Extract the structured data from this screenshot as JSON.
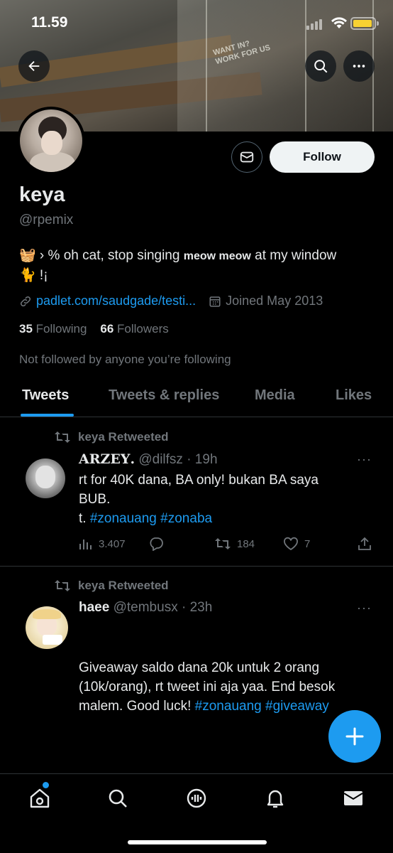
{
  "status_bar": {
    "time": "11.59"
  },
  "banner": {
    "sign_text": "WANT IN? WORK FOR US"
  },
  "profile": {
    "name": "keya",
    "handle": "@rpemix",
    "bio_prefix": "🧺 › % oh cat, stop singing ",
    "bio_bold": "meow meow",
    "bio_suffix": " at my window",
    "bio_line2": "🐈 !¡",
    "link": "padlet.com/saudgade/testi...",
    "joined": "Joined May 2013",
    "following_count": "35",
    "following_label": "Following",
    "followers_count": "66",
    "followers_label": "Followers",
    "not_followed": "Not followed by anyone you’re following",
    "follow_label": "Follow"
  },
  "tabs": [
    {
      "label": "Tweets",
      "active": true
    },
    {
      "label": "Tweets & replies"
    },
    {
      "label": "Media"
    },
    {
      "label": "Likes"
    }
  ],
  "tweets": [
    {
      "retweet_label": "keya Retweeted",
      "display_name": "𝐀𝐑𝐙𝐄𝐘.",
      "handle_time": "@dilfsz · 19h",
      "text_line1": "rt for 40K dana, BA only! bukan BA saya",
      "text_line2": "BUB.",
      "text_line3_prefix": "t. ",
      "hashtag1": "#zonauang",
      "hashtag2": "#zonaba",
      "views": "3.407",
      "retweets": "184",
      "likes": "7"
    },
    {
      "retweet_label": "keya Retweeted",
      "display_name": "haee",
      "handle_time": "@tembusx · 23h",
      "text_line1": "Giveaway saldo dana 20k untuk 2 orang",
      "text_line2": "(10k/orang), rt tweet ini aja yaa. End besok",
      "text_line3_prefix": "malem. Good luck! ",
      "hashtag1": "#zonauang",
      "hashtag2": "#giveaway"
    }
  ],
  "colors": {
    "accent": "#1d9bf0",
    "background": "#000000",
    "muted": "#71767b",
    "text": "#e7e9ea"
  },
  "icons": [
    "back-arrow-icon",
    "search-icon",
    "more-icon",
    "mail-icon",
    "link-icon",
    "calendar-icon",
    "retweet-icon",
    "views-icon",
    "reply-icon",
    "like-icon",
    "share-icon",
    "compose-icon",
    "home-icon",
    "explore-icon",
    "spaces-icon",
    "notifications-icon",
    "messages-icon"
  ]
}
